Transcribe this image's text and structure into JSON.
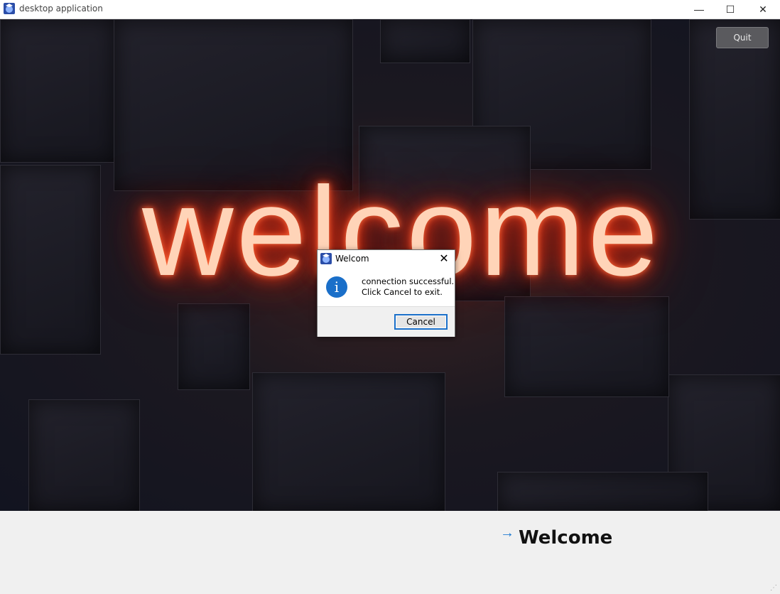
{
  "window": {
    "title": "desktop application",
    "icon": "app-logo-icon",
    "controls": {
      "minimize": "—",
      "maximize": "☐",
      "close": "✕"
    }
  },
  "scene": {
    "neon_text": "welcome",
    "quit_label": "Quit"
  },
  "dialog": {
    "title": "Welcom",
    "icon": "info-icon",
    "message_line1": "connection successful.",
    "message_line2": "Click Cancel to exit.",
    "cancel_label": "Cancel",
    "close_glyph": "✕"
  },
  "bottom": {
    "arrow": "→",
    "label": "Welcome"
  },
  "colors": {
    "accent": "#1a6fc9",
    "neon": "#ff3d1a"
  }
}
